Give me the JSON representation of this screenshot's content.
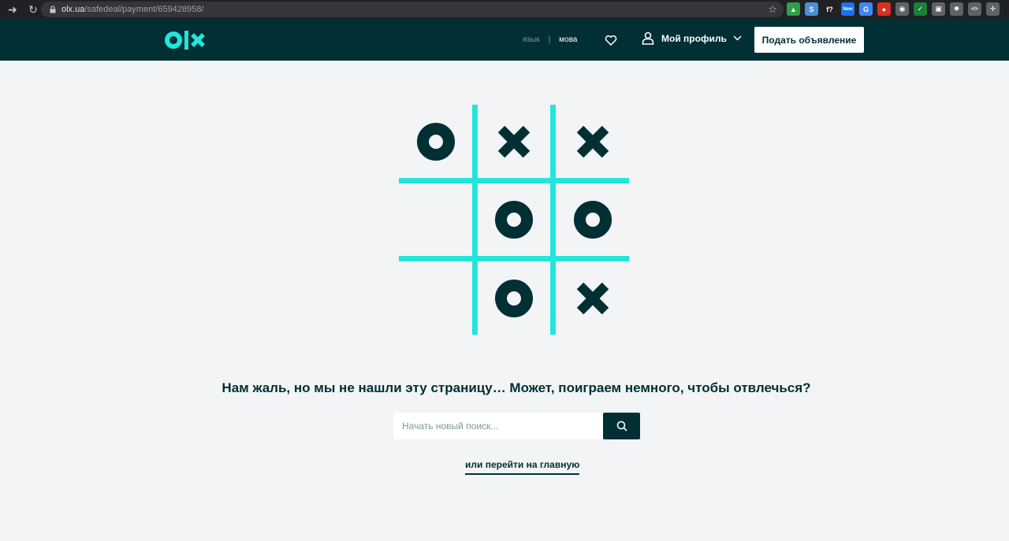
{
  "browser": {
    "url_host": "olx.ua",
    "url_path": "/safedeal/payment/659428958/",
    "extensions": [
      {
        "name": "drive-ext-icon",
        "color": "#2f9e49",
        "glyph": "▲"
      },
      {
        "name": "s-ext-icon",
        "color": "#4a90d9",
        "glyph": "S"
      },
      {
        "name": "font-ext-icon",
        "color": "#202124",
        "glyph": "f?"
      },
      {
        "name": "new-ext-icon",
        "color": "#1a73e8",
        "glyph": "New"
      },
      {
        "name": "translate-ext-icon",
        "color": "#4285f4",
        "glyph": "G"
      },
      {
        "name": "red-ext-icon",
        "color": "#d93025",
        "glyph": "●"
      },
      {
        "name": "eye-ext-icon",
        "color": "#5f6368",
        "glyph": "◉"
      },
      {
        "name": "green-ext-icon",
        "color": "#188038",
        "glyph": "✓"
      },
      {
        "name": "window-ext-icon",
        "color": "#5f6368",
        "glyph": "▣"
      },
      {
        "name": "gear-ext-icon",
        "color": "#5f6368",
        "glyph": "✹"
      },
      {
        "name": "code-ext-icon",
        "color": "#5f6368",
        "glyph": "</>"
      },
      {
        "name": "puzzle-ext-icon",
        "color": "#5f6368",
        "glyph": "✛"
      }
    ]
  },
  "header": {
    "lang_inactive": "язык",
    "lang_active": "мова",
    "profile_label": "Мой профиль",
    "post_button": "Подать объявление"
  },
  "game": {
    "board": [
      [
        "O",
        "X",
        "X"
      ],
      [
        "",
        "O",
        "O"
      ],
      [
        "",
        "O",
        "X"
      ]
    ]
  },
  "main": {
    "message": "Нам жаль, но мы не нашли эту страницу… Может, поиграем немного, чтобы отвлечься?",
    "search_placeholder": "Начать новый поиск...",
    "home_link": "или перейти на главную"
  },
  "colors": {
    "brand_dark": "#002f34",
    "accent": "#23e5db",
    "background": "#f2f4f5"
  }
}
